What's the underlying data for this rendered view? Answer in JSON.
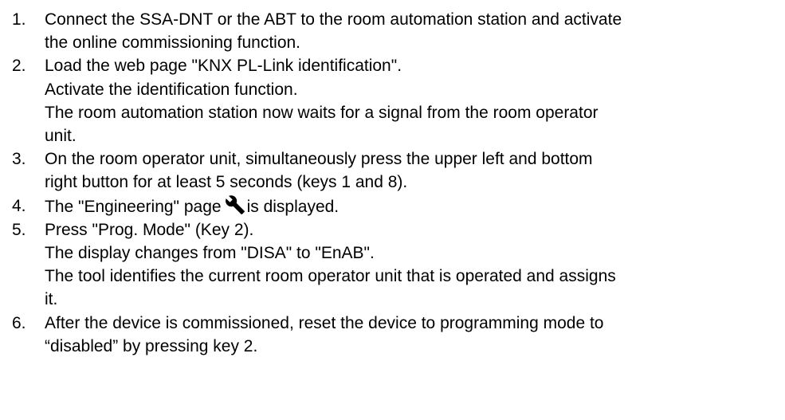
{
  "steps": [
    {
      "number": "1.",
      "lines": [
        "Connect the SSA-DNT or the ABT to the room automation station and activate",
        "the online commissioning function."
      ]
    },
    {
      "number": "2.",
      "lines": [
        "Load the web page \"KNX PL-Link identification\".",
        "Activate the identification function.",
        "The room automation station now waits for a signal from the room operator",
        "unit."
      ]
    },
    {
      "number": "3.",
      "lines": [
        "On the room operator unit, simultaneously press the upper left and bottom",
        "right button for at least 5 seconds (keys 1 and 8)."
      ]
    },
    {
      "number": "4.",
      "text_before_icon": "The \"Engineering\" page",
      "icon": "wrench-icon",
      "text_after_icon": "is displayed."
    },
    {
      "number": "5.",
      "lines": [
        "Press \"Prog. Mode\" (Key 2).",
        "The display changes from \"DISA\" to \"EnAB\".",
        "The tool identifies the current room operator unit that is operated and assigns",
        "it."
      ]
    },
    {
      "number": "6.",
      "lines": [
        "After the device is commissioned, reset the device to programming mode to",
        "“disabled” by pressing key 2."
      ]
    }
  ]
}
